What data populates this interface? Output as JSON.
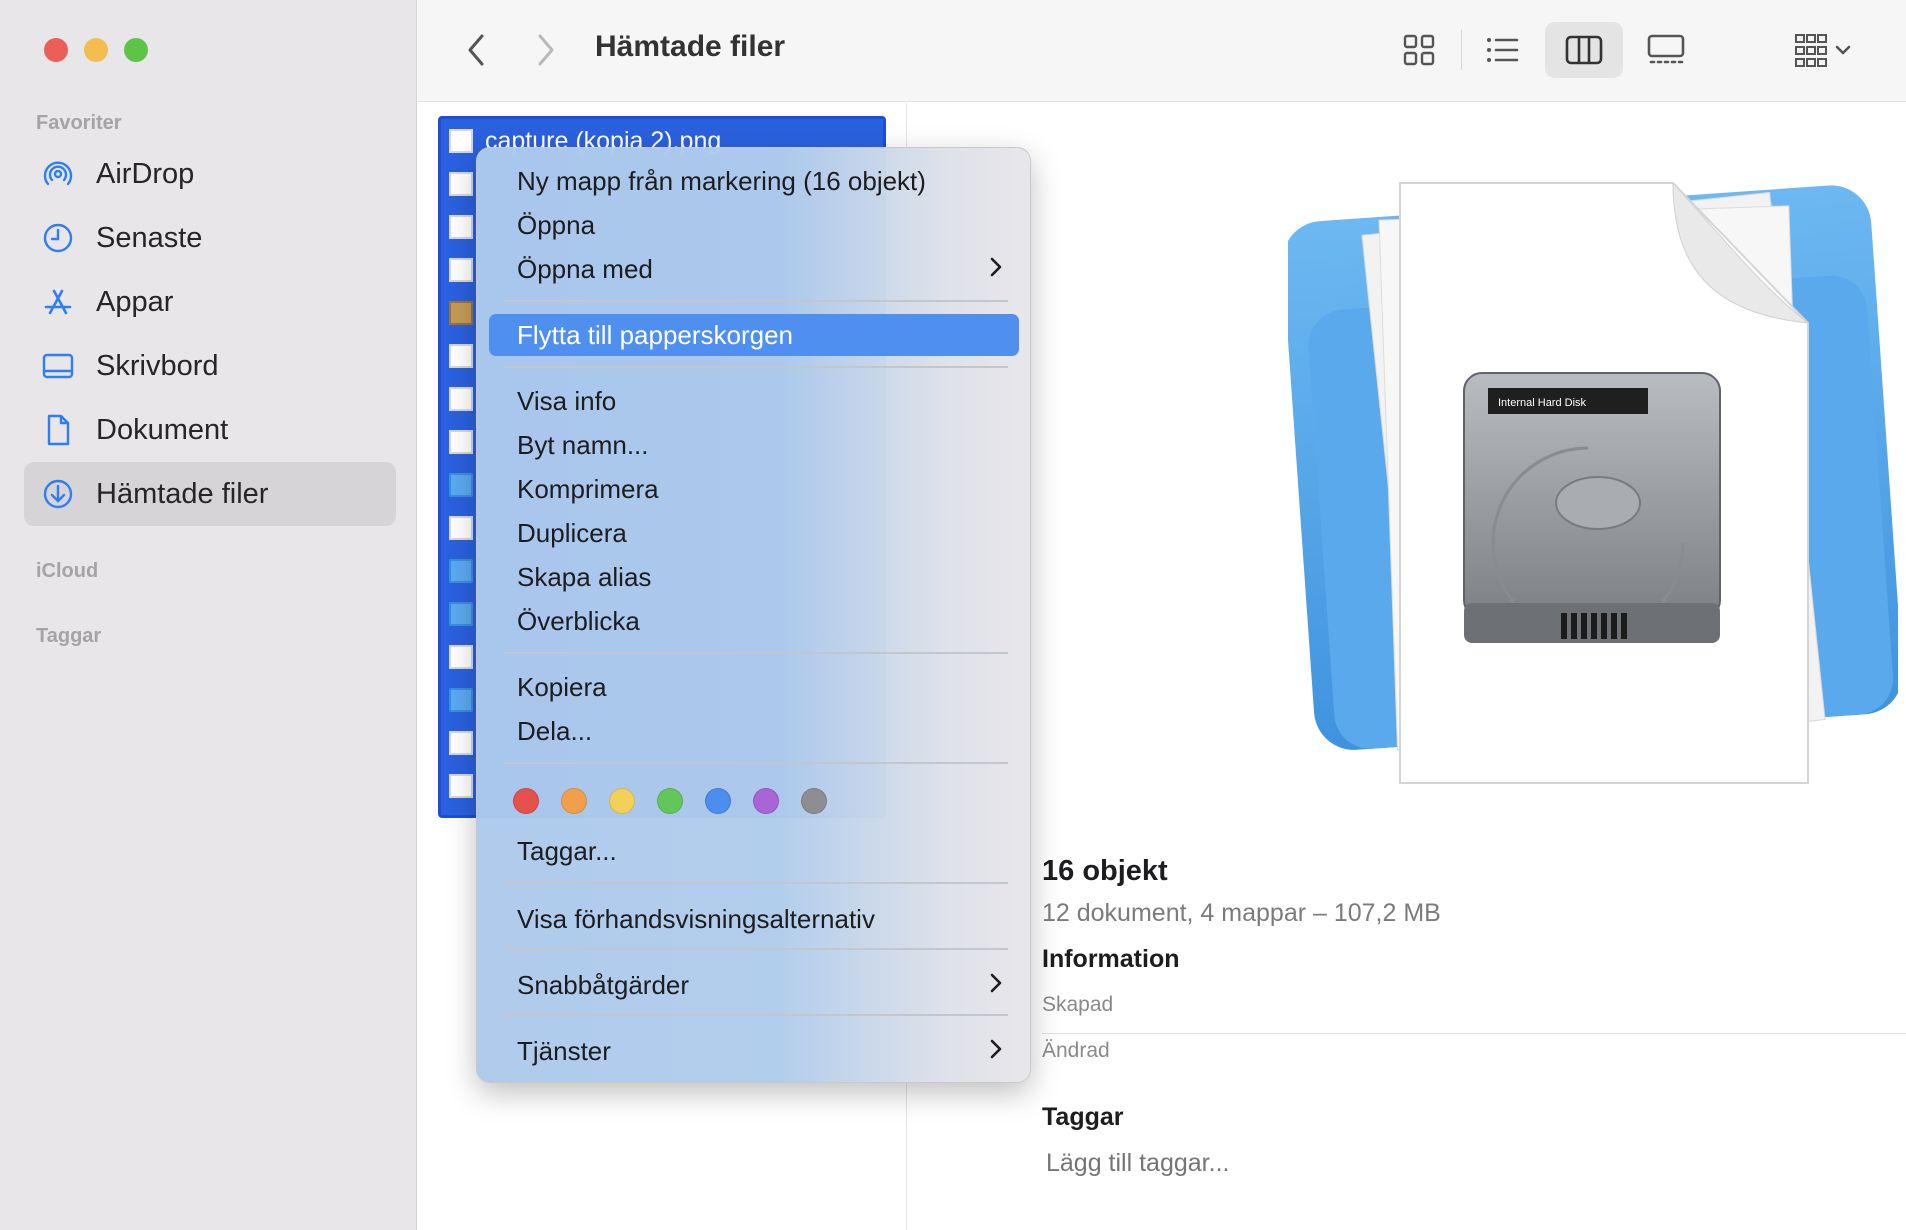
{
  "sidebar": {
    "window_controls": [
      "close",
      "minimize",
      "zoom"
    ],
    "sections": {
      "favorites": "Favoriter",
      "icloud": "iCloud",
      "tags": "Taggar"
    },
    "items": [
      {
        "label": "AirDrop",
        "icon": "airdrop-icon"
      },
      {
        "label": "Senaste",
        "icon": "clock-icon"
      },
      {
        "label": "Appar",
        "icon": "apps-icon"
      },
      {
        "label": "Skrivbord",
        "icon": "desktop-icon"
      },
      {
        "label": "Dokument",
        "icon": "document-icon"
      },
      {
        "label": "Hämtade filer",
        "icon": "download-icon",
        "active": true
      }
    ]
  },
  "toolbar": {
    "title": "Hämtade filer",
    "views": [
      "icon-view",
      "list-view",
      "column-view",
      "gallery-view"
    ],
    "active_view": "column-view"
  },
  "column": {
    "selected_file": "capture (kopia 2).png",
    "row_types": [
      "png",
      "doc",
      "doc",
      "doc",
      "pkg",
      "img",
      "img",
      "img",
      "folder",
      "doc",
      "folder",
      "folder",
      "zip",
      "folder",
      "zip",
      "img"
    ]
  },
  "menu": {
    "new_folder": "Ny mapp från markering (16 objekt)",
    "open": "Öppna",
    "open_with": "Öppna med",
    "move_to_trash": "Flytta till papperskorgen",
    "get_info": "Visa info",
    "rename": "Byt namn...",
    "compress": "Komprimera",
    "duplicate": "Duplicera",
    "make_alias": "Skapa alias",
    "quick_look": "Överblicka",
    "copy": "Kopiera",
    "share": "Dela...",
    "tag_colors": [
      "#e5524c",
      "#f0a04a",
      "#f3d05a",
      "#62c65a",
      "#4b8ef0",
      "#a964d6",
      "#8e8e92"
    ],
    "tags": "Taggar...",
    "show_preview_options": "Visa förhandsvisningsalternativ",
    "quick_actions": "Snabbåtgärder",
    "services": "Tjänster"
  },
  "preview": {
    "title": "16 objekt",
    "subtitle": "12 dokument, 4 mappar – 107,2 MB",
    "info_heading": "Information",
    "created_label": "Skapad",
    "modified_label": "Ändrad",
    "tags_heading": "Taggar",
    "tags_placeholder": "Lägg till taggar...",
    "disk_label": "Internal Hard Disk"
  }
}
